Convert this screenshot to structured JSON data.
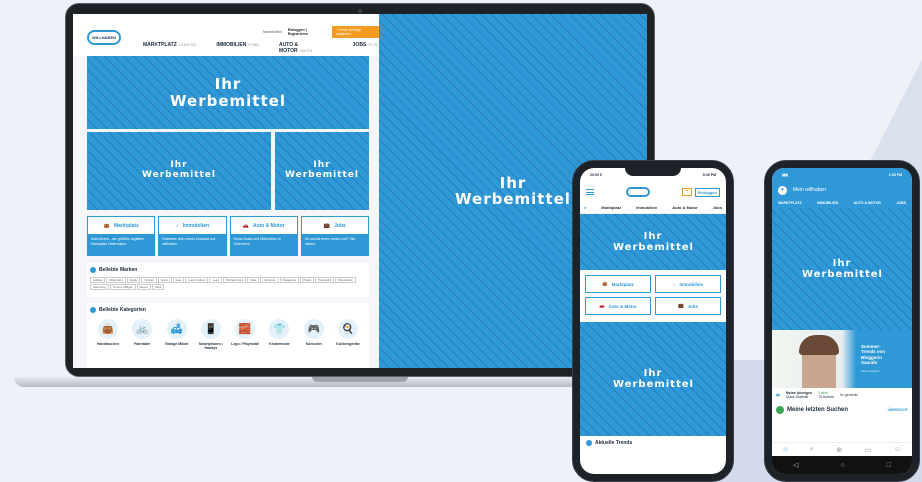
{
  "ad_label": "Ihr Werbemittel",
  "desktop": {
    "logo": "WILLHABEN",
    "top_links": {
      "messages": "Nachrichten",
      "login": "Einloggen | Registrieren",
      "new_ad": "+ Neue Anzeige aufgeben"
    },
    "nav": [
      {
        "label": "MARKTPLATZ",
        "count": "10.800.324"
      },
      {
        "label": "IMMOBILIEN",
        "count": "97.866"
      },
      {
        "label": "AUTO & MOTOR",
        "count": "165.379"
      },
      {
        "label": "JOBS",
        "count": "22.787"
      }
    ],
    "categories": [
      {
        "label": "Marktplatz",
        "text": "Alles finden - am größten digitalen Marktplatz Österreichs",
        "icon": "shopping-bag-icon"
      },
      {
        "label": "Immobilien",
        "text": "Entdecke dein neues Zuhause auf willhaben",
        "icon": "house-icon"
      },
      {
        "label": "Auto & Motor",
        "text": "Deine Autos und Motorräder in Österreich",
        "icon": "car-icon"
      },
      {
        "label": "Jobs",
        "text": "Du suchst einen neuen Job? Wir haben!",
        "icon": "briefcase-icon"
      }
    ],
    "brands_title": "Beliebte Marken",
    "brands": [
      "Adidas",
      "Affenzahn",
      "Apple",
      "Chanel",
      "Gucci",
      "Ikea",
      "Louis Vuitton",
      "Lego",
      "Michael Kors",
      "Nike",
      "Nintendo",
      "Patagonia",
      "Prada",
      "Playmobil",
      "Playstation",
      "Samsung",
      "Tommy Hilfiger",
      "Woom",
      "Zara"
    ],
    "kategorien_title": "Beliebte Kategorien",
    "kategorien": [
      {
        "label": "Handtaschen",
        "glyph": "👜"
      },
      {
        "label": "Fahrräder",
        "glyph": "🚲"
      },
      {
        "label": "Vintage Möbel",
        "glyph": "🛋"
      },
      {
        "label": "Smartphones / Handys",
        "glyph": "📱"
      },
      {
        "label": "Lego / Playmobil",
        "glyph": "🧱"
      },
      {
        "label": "Kindermode",
        "glyph": "👕"
      },
      {
        "label": "Konsolen",
        "glyph": "🎮"
      },
      {
        "label": "Küchengeräte",
        "glyph": "🍳"
      }
    ]
  },
  "phone1": {
    "time": "20:00 5",
    "battery": "5:40 PM",
    "login": "Einloggen",
    "tabs": [
      "Marktplatz",
      "Immobilien",
      "Auto & Motor",
      "Jobs"
    ],
    "cards": [
      {
        "label": "Marktplatz",
        "icon": "shopping-bag-icon"
      },
      {
        "label": "Immobilien",
        "icon": "house-icon"
      },
      {
        "label": "Auto & Motor",
        "icon": "car-icon"
      },
      {
        "label": "Jobs",
        "icon": "briefcase-icon"
      }
    ],
    "trends": "Aktuelle Trends"
  },
  "phone2": {
    "time": "1:53 PM",
    "title": "Mein willhaben",
    "nav": [
      "MARKTPLATZ",
      "IMMOBILIEN",
      "AUTO & MOTOR",
      "JOBS"
    ],
    "banner_title": "Sommer-Trends von Bloggerin Saarah!",
    "banner_sub": "Jetzt shoppen",
    "stats": {
      "label": "Meine Anzeigen",
      "sub": "Quick-Statistik",
      "active": "2 aktiv",
      "saved": "0x gemerkt",
      "views": "75 Aufrufe"
    },
    "last_search": "Meine letzten Suchen",
    "overview": "ÜBERSICHT"
  },
  "colors": {
    "brand": "#2f98d6",
    "accent": "#f39c21"
  }
}
